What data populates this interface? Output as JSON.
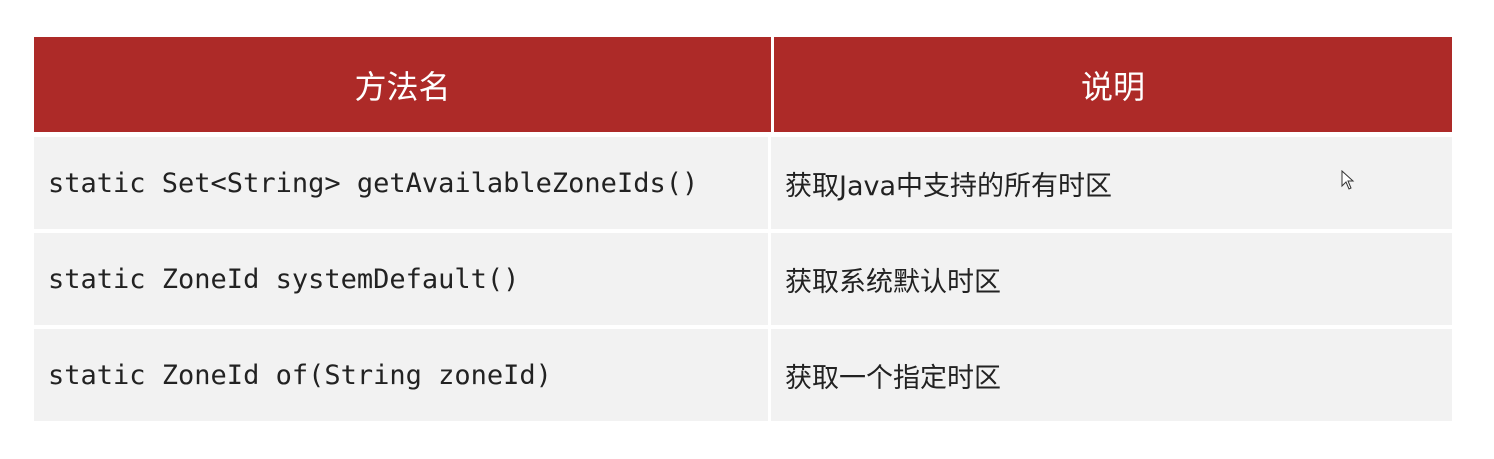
{
  "table": {
    "headers": [
      "方法名",
      "说明"
    ],
    "rows": [
      {
        "method": "static Set<String> getAvailableZoneIds()",
        "desc": "获取Java中支持的所有时区"
      },
      {
        "method": "static ZoneId systemDefault()",
        "desc": "获取系统默认时区"
      },
      {
        "method": "static ZoneId of(String zoneId)",
        "desc": "获取一个指定时区"
      }
    ]
  },
  "colors": {
    "header_bg": "#AD2A28",
    "row_bg": "#F2F2F2"
  },
  "cursor_icon": "mouse-pointer-icon"
}
